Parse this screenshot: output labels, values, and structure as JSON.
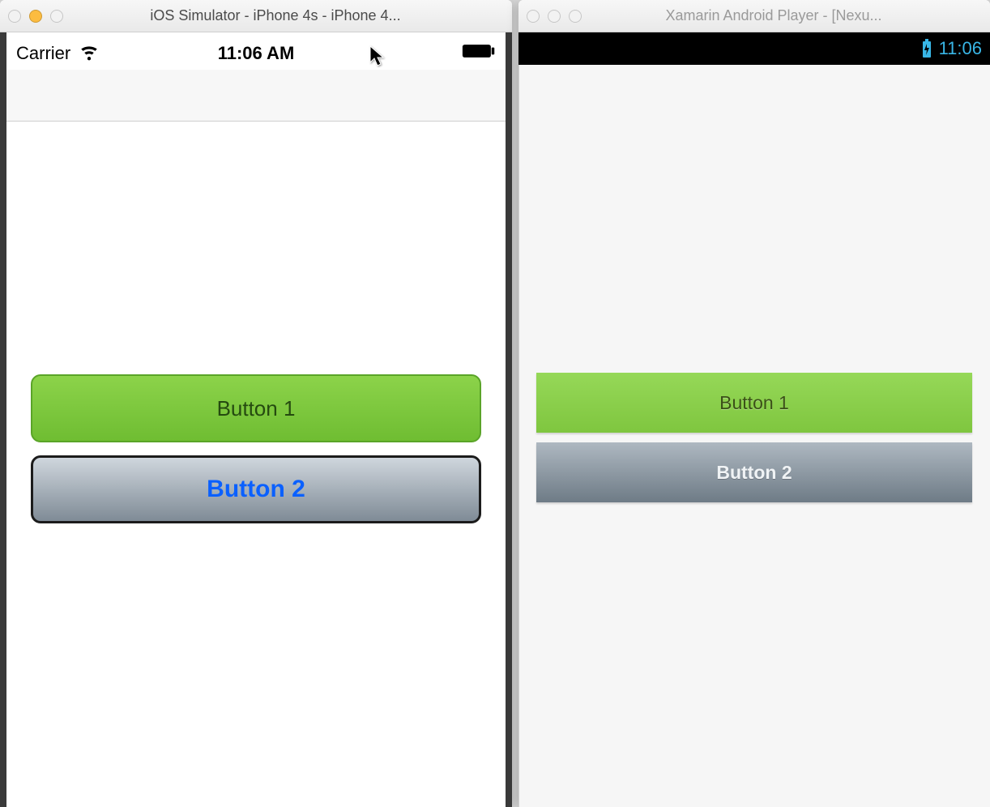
{
  "ios_window": {
    "title": "iOS Simulator - iPhone 4s - iPhone 4...",
    "statusbar": {
      "carrier": "Carrier",
      "time": "11:06 AM"
    },
    "buttons": {
      "b1": "Button 1",
      "b2": "Button 2"
    }
  },
  "android_window": {
    "title": "Xamarin Android Player - [Nexu...",
    "statusbar": {
      "time": "11:06"
    },
    "buttons": {
      "b1": "Button 1",
      "b2": "Button 2"
    }
  }
}
